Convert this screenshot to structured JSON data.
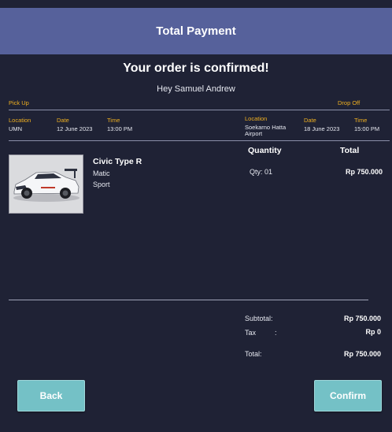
{
  "header": {
    "title": "Total Payment"
  },
  "confirmation": {
    "title": "Your order is confirmed!",
    "greeting": "Hey Samuel Andrew"
  },
  "route": {
    "pickup_label": "Pick Up",
    "dropoff_label": "Drop Off",
    "pickup": {
      "location_label": "Location",
      "location": "UMN",
      "date_label": "Date",
      "date": "12 June 2023",
      "time_label": "Time",
      "time": "13:00 PM"
    },
    "dropoff": {
      "location_label": "Location",
      "location_line1": "Soekarno Hatta",
      "location_line2": "Airport",
      "date_label": "Date",
      "date": "18 June 2023",
      "time_label": "Time",
      "time": "15:00 PM"
    }
  },
  "order_table": {
    "quantity_header": "Quantity",
    "total_header": "Total",
    "item": {
      "name": "Civic Type R",
      "spec1": "Matic",
      "spec2": "Sport",
      "qty": "Qty: 01",
      "total": "Rp 750.000"
    }
  },
  "summary": {
    "subtotal_label": "Subtotal:",
    "subtotal_value": "Rp 750.000",
    "tax_label": "Tax",
    "tax_colon": ":",
    "tax_value": "Rp 0",
    "total_label": "Total:",
    "total_value": "Rp 750.000"
  },
  "actions": {
    "back_label": "Back",
    "confirm_label": "Confirm"
  },
  "colors": {
    "background": "#1f2235",
    "header": "#56619b",
    "accent_label": "#f0b020",
    "button": "#74c1c6"
  }
}
